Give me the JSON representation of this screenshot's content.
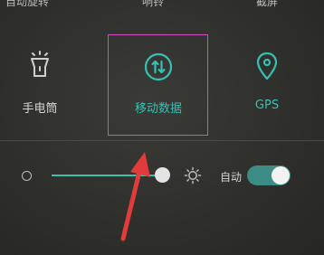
{
  "top_row": {
    "labels": [
      "自动旋转",
      "响铃",
      "截屏"
    ]
  },
  "quick_settings": {
    "tiles": [
      {
        "label": "手电筒",
        "icon": "flashlight-icon",
        "active": false
      },
      {
        "label": "移动数据",
        "icon": "mobile-data-icon",
        "active": true
      },
      {
        "label": "GPS",
        "icon": "location-pin-icon",
        "active": true
      }
    ]
  },
  "brightness": {
    "level": 1.0,
    "auto_label": "自动",
    "auto_enabled": true,
    "icons": {
      "low": "brightness-low-icon",
      "high": "brightness-high-icon"
    }
  },
  "annotation": {
    "highlight": "red-box-highlight",
    "arrow": "red-arrow"
  },
  "colors": {
    "active_teal": "#35c2b4",
    "highlight_border": "#d04fc9",
    "arrow_red": "#e23b3b",
    "toggle_on": "#3a8c84"
  }
}
